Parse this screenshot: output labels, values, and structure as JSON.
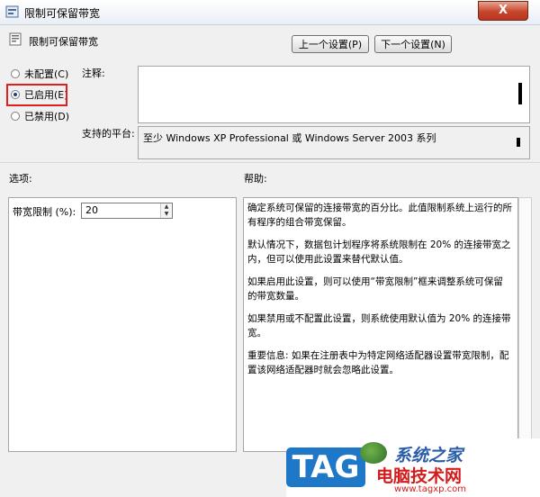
{
  "window": {
    "title": "限制可保留带宽",
    "close_glyph": "X"
  },
  "header": {
    "title": "限制可保留带宽"
  },
  "nav": {
    "prev_label": "上一个设置(P)",
    "next_label": "下一个设置(N)"
  },
  "state": {
    "options": [
      {
        "label": "未配置(C)",
        "checked": false
      },
      {
        "label": "已启用(E)",
        "checked": true
      },
      {
        "label": "已禁用(D)",
        "checked": false
      }
    ]
  },
  "comment": {
    "label": "注释:"
  },
  "platform": {
    "label": "支持的平台:",
    "value": "至少 Windows XP Professional 或 Windows Server 2003 系列"
  },
  "sections": {
    "options_label": "选项:",
    "help_label": "帮助:"
  },
  "bandwidth": {
    "label": "带宽限制 (%):",
    "value": "20"
  },
  "help": {
    "paragraphs": [
      "确定系统可保留的连接带宽的百分比。此值限制系统上运行的所有程序的组合带宽保留。",
      "默认情况下，数据包计划程序将系统限制在 20% 的连接带宽之内，但可以使用此设置来替代默认值。",
      "如果启用此设置，则可以使用“带宽限制”框来调整系统可保留的带宽数量。",
      "如果禁用或不配置此设置，则系统使用默认值为 20% 的连接带宽。",
      "重要信息: 如果在注册表中为特定网络适配器设置带宽限制，配置该网络适配器时就会忽略此设置。"
    ]
  },
  "watermark": {
    "badge": "TAG",
    "top_text": "系统之家",
    "mid_text": "电脑技术网",
    "url": "www.tagxp.com"
  }
}
